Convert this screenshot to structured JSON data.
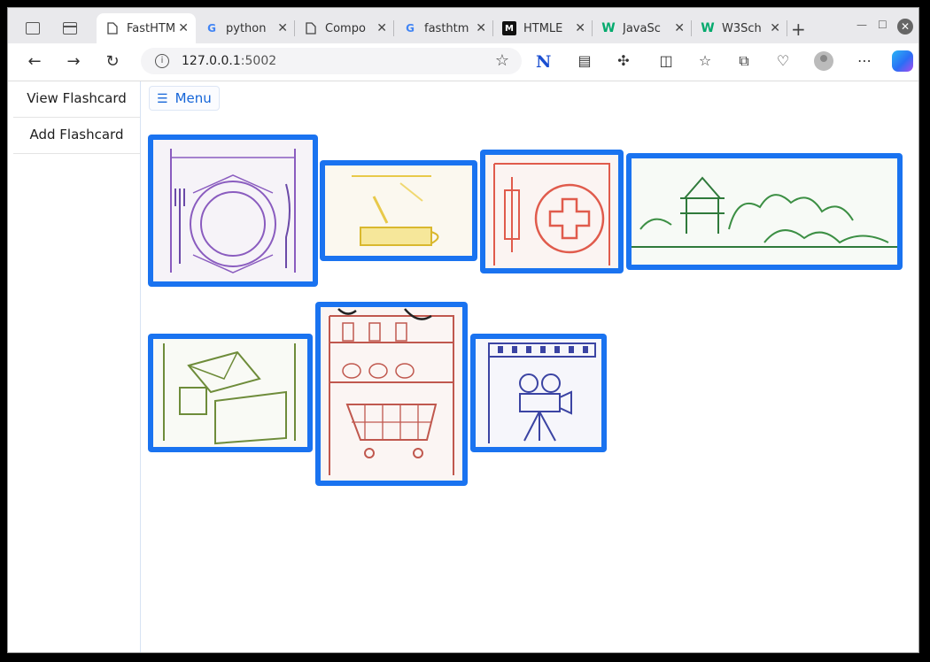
{
  "browser": {
    "tabs": [
      {
        "title": "FastHTML",
        "icon": "page-icon",
        "active": true
      },
      {
        "title": "python",
        "icon": "google-icon"
      },
      {
        "title": "Compo",
        "icon": "page-icon"
      },
      {
        "title": "fasthtm",
        "icon": "google-icon"
      },
      {
        "title": "HTMLE",
        "icon": "m-logo-icon"
      },
      {
        "title": "JavaSc",
        "icon": "w3-icon"
      },
      {
        "title": "W3Sch",
        "icon": "w3-icon"
      }
    ],
    "url_host": "127.0.0.1",
    "url_port": ":5002"
  },
  "sidebar": {
    "items": [
      {
        "label": "View Flashcard"
      },
      {
        "label": "Add Flashcard"
      }
    ]
  },
  "menu": {
    "label": "Menu"
  },
  "cards": [
    {
      "name": "dining-card",
      "extra_text": ""
    },
    {
      "name": "cafe-card",
      "extra_text": ""
    },
    {
      "name": "hospital-card",
      "extra_text": ""
    },
    {
      "name": "park-card",
      "extra_text": ""
    },
    {
      "name": "post-office-card",
      "extra_text": ""
    },
    {
      "name": "supermarket-card",
      "extra_text": ""
    },
    {
      "name": "cinema-card",
      "extra_text": ""
    }
  ],
  "colors": {
    "card_border": "#1a73f0",
    "menu_text": "#1565d8"
  }
}
